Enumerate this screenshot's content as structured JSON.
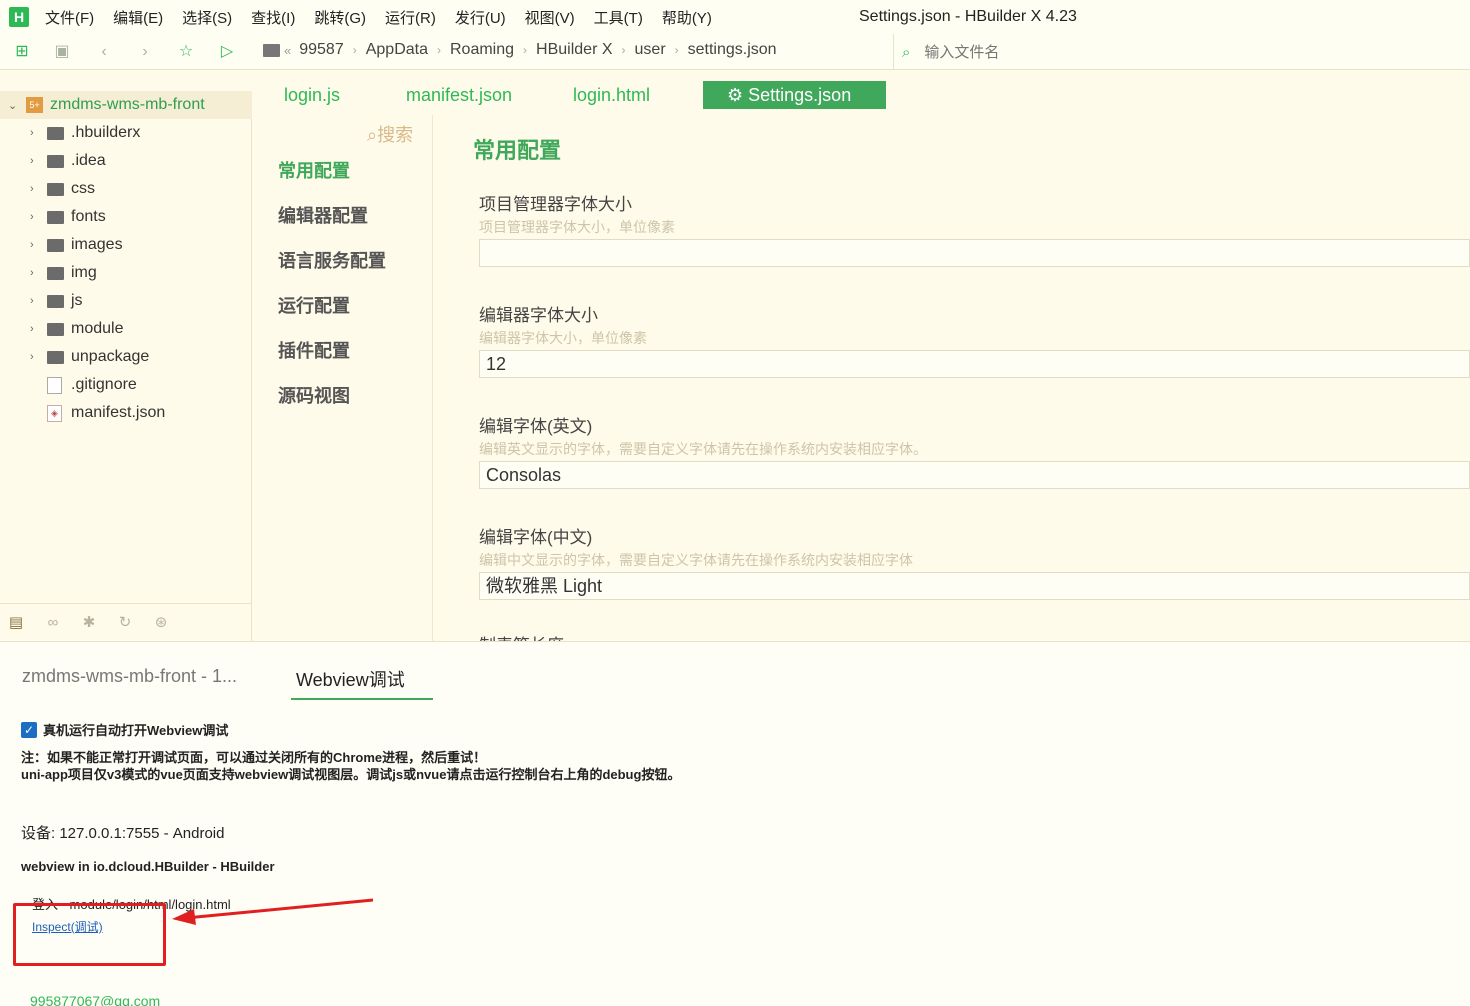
{
  "app": {
    "logo": "H",
    "window_title": "Settings.json - HBuilder X 4.23"
  },
  "menu": [
    "文件(F)",
    "编辑(E)",
    "选择(S)",
    "查找(I)",
    "跳转(G)",
    "运行(R)",
    "发行(U)",
    "视图(V)",
    "工具(T)",
    "帮助(Y)"
  ],
  "toolbar": {
    "icons": [
      "new-file-icon",
      "save-icon",
      "back-icon",
      "forward-icon",
      "star-icon",
      "run-icon"
    ],
    "breadcrumb": [
      "«",
      "99587",
      "AppData",
      "Roaming",
      "HBuilder X",
      "user",
      "settings.json"
    ],
    "file_search_placeholder": "输入文件名"
  },
  "tree": {
    "root": "zmdms-wms-mb-front",
    "root_icon": "5+",
    "folders": [
      ".hbuilderx",
      ".idea",
      "css",
      "fonts",
      "images",
      "img",
      "js",
      "module",
      "unpackage"
    ],
    "files": [
      ".gitignore",
      "manifest.json"
    ],
    "bottom_icons": [
      "project-icon",
      "binoculars-icon",
      "bug-icon",
      "refresh-icon",
      "plugin-icon"
    ]
  },
  "editor_tabs": [
    "login.js",
    "manifest.json",
    "login.html",
    "Settings.json"
  ],
  "settings": {
    "search_label": "搜索",
    "nav": [
      "常用配置",
      "编辑器配置",
      "语言服务配置",
      "运行配置",
      "插件配置",
      "源码视图"
    ],
    "section_title": "常用配置",
    "items": [
      {
        "label": "项目管理器字体大小",
        "desc": "项目管理器字体大小，单位像素",
        "value": ""
      },
      {
        "label": "编辑器字体大小",
        "desc": "编辑器字体大小，单位像素",
        "value": "12"
      },
      {
        "label": "编辑字体(英文)",
        "desc": "编辑英文显示的字体，需要自定义字体请先在操作系统内安装相应字体。",
        "value": "Consolas"
      },
      {
        "label": "编辑字体(中文)",
        "desc": "编辑中文显示的字体，需要自定义字体请先在操作系统内安装相应字体",
        "value": "微软雅黑 Light"
      },
      {
        "label": "制表符长度",
        "desc": "",
        "value": ""
      }
    ]
  },
  "bottom_panel": {
    "tabs": [
      "zmdms-wms-mb-front - 1...",
      "Webview调试"
    ],
    "checkbox_label": "真机运行自动打开Webview调试",
    "checkbox_checked": true,
    "note_line1": "注：如果不能正常打开调试页面，可以通过关闭所有的Chrome进程，然后重试！",
    "note_line2": "uni-app项目仅v3模式的vue页面支持webview调试视图层。调试js或nvue请点击运行控制台右上角的debug按钮。",
    "device": "设备: 127.0.0.1:7555 - Android",
    "webview": "webview in io.dcloud.HBuilder - HBuilder",
    "page": "登入 - module/login/html/login.html",
    "inspect": "Inspect(调试)"
  },
  "statusbar": {
    "email": "995877067@qq.com"
  },
  "colors": {
    "accent": "#3fa85a",
    "background": "#fffbea",
    "annotation": "#e02020"
  }
}
